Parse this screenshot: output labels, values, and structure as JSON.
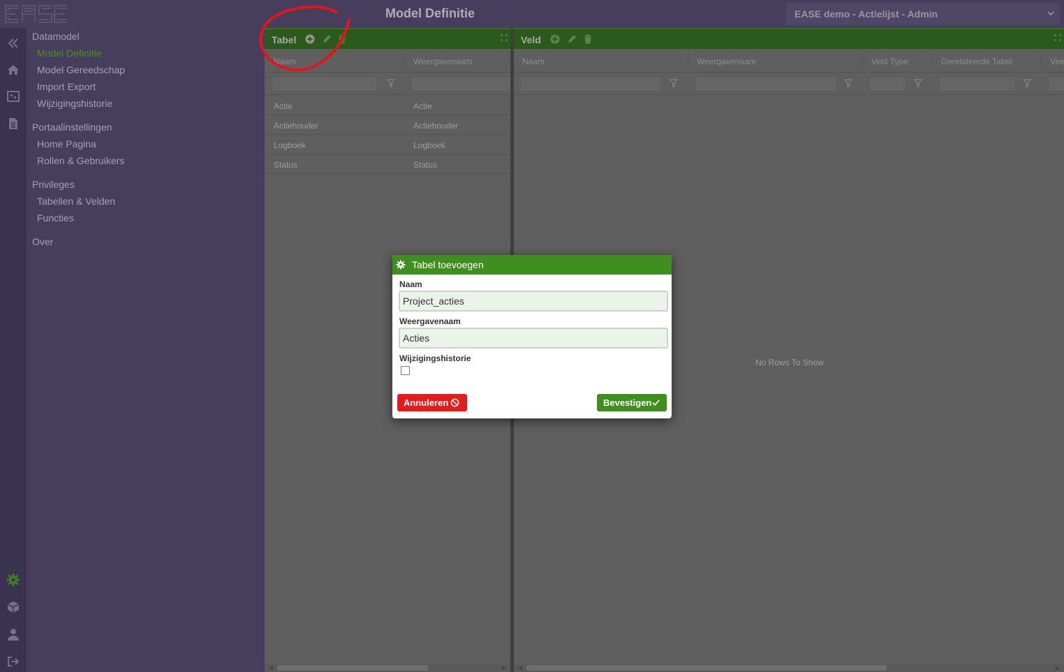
{
  "header": {
    "title": "Model Definitie",
    "environment": "EASE demo - Actielijst - Admin"
  },
  "nav": {
    "groups": [
      {
        "label": "Datamodel",
        "items": [
          "Model Definitie",
          "Model Gereedschap",
          "Import Export",
          "Wijzigingshistorie"
        ]
      },
      {
        "label": "Portaalinstellingen",
        "items": [
          "Home Pagina",
          "Rollen & Gebruikers"
        ]
      },
      {
        "label": "Privileges",
        "items": [
          "Tabellen & Velden",
          "Functies"
        ]
      },
      {
        "label": "Over",
        "items": []
      }
    ],
    "active_item": "Model Definitie"
  },
  "rail_icons": [
    "collapse-icon",
    "home-icon",
    "model-icon",
    "document-icon",
    "settings-icon",
    "package-icon",
    "user-icon",
    "logout-icon"
  ],
  "tabel_panel": {
    "title": "Tabel",
    "columns": [
      "Naam",
      "Weergavenaam"
    ],
    "rows": [
      [
        "Actie",
        "Actie"
      ],
      [
        "Actiehouder",
        "Actiehouder"
      ],
      [
        "Logboek",
        "Logboek"
      ],
      [
        "Status",
        "Status"
      ]
    ]
  },
  "veld_panel": {
    "title": "Veld",
    "columns": [
      "Naam",
      "Weergavenaam",
      "Veld Type",
      "Gerelateerde Tabel",
      "Vee"
    ],
    "empty_text": "No Rows To Show"
  },
  "dialog": {
    "title": "Tabel toevoegen",
    "naam_label": "Naam",
    "naam_value": "Project_acties",
    "weergavenaam_label": "Weergavenaam",
    "weergavenaam_value": "Acties",
    "historie_label": "Wijzigingshistorie",
    "historie_checked": false,
    "cancel_label": "Annuleren",
    "confirm_label": "Bevestigen"
  },
  "colors": {
    "accent_green": "#3f8f1e",
    "cancel_red": "#e41c1c",
    "annotation_red": "#e0161a",
    "sidebar": "#463e5c"
  }
}
